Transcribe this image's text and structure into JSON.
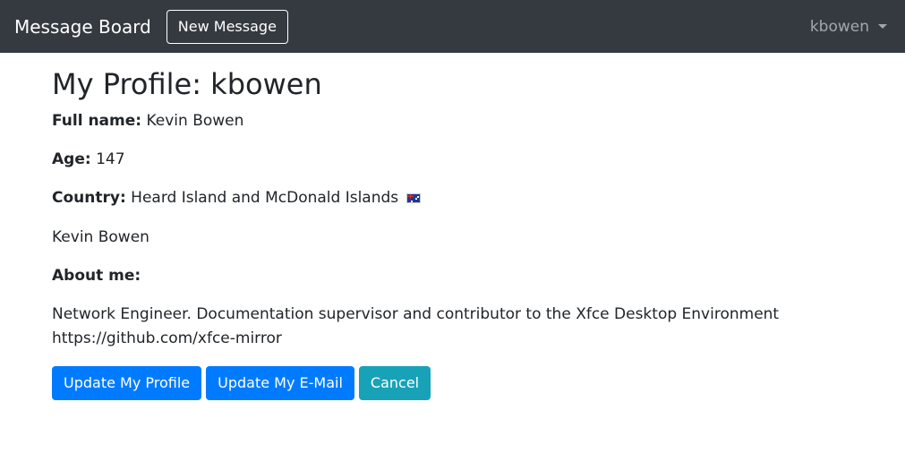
{
  "navbar": {
    "brand": "Message Board",
    "new_message_label": "New Message",
    "username": "kbowen"
  },
  "profile": {
    "title": "My Profile: kbowen",
    "full_name_label": "Full name:",
    "full_name": "Kevin Bowen",
    "age_label": "Age:",
    "age": "147",
    "country_label": "Country:",
    "country": "Heard Island and McDonald Islands",
    "display_name": "Kevin Bowen",
    "about_label": "About me:",
    "about_line1": "Network Engineer. Documentation supervisor and contributor to the Xfce Desktop Environment",
    "about_line2": "https://github.com/xfce-mirror"
  },
  "actions": {
    "update_profile_label": "Update My Profile",
    "update_email_label": "Update My E-Mail",
    "cancel_label": "Cancel"
  },
  "colors": {
    "navbar_bg": "#343a40",
    "primary": "#007bff",
    "info": "#17a2b8"
  },
  "icons": {
    "flag": "heard-island-flag-icon",
    "dropdown": "caret-down-icon"
  }
}
